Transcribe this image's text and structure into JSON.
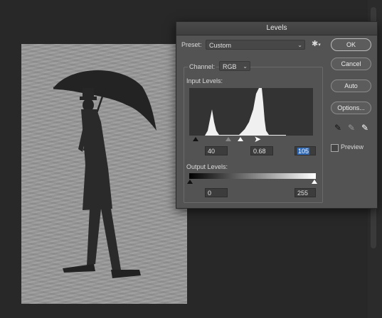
{
  "dialog": {
    "title": "Levels",
    "preset_label": "Preset:",
    "preset_value": "Custom",
    "channel_label": "Channel:",
    "channel_value": "RGB",
    "input_levels_label": "Input Levels:",
    "input_black": "40",
    "input_gamma": "0.68",
    "input_white": "105",
    "output_levels_label": "Output Levels:",
    "output_black": "0",
    "output_white": "255",
    "buttons": {
      "ok": "OK",
      "cancel": "Cancel",
      "auto": "Auto",
      "options": "Options..."
    },
    "preview_label": "Preview",
    "preview_checked": false
  },
  "icons": {
    "gear": "gear-icon",
    "black_eyedropper": "black-eyedropper-icon",
    "gray_eyedropper": "gray-eyedropper-icon",
    "white_eyedropper": "white-eyedropper-icon"
  }
}
